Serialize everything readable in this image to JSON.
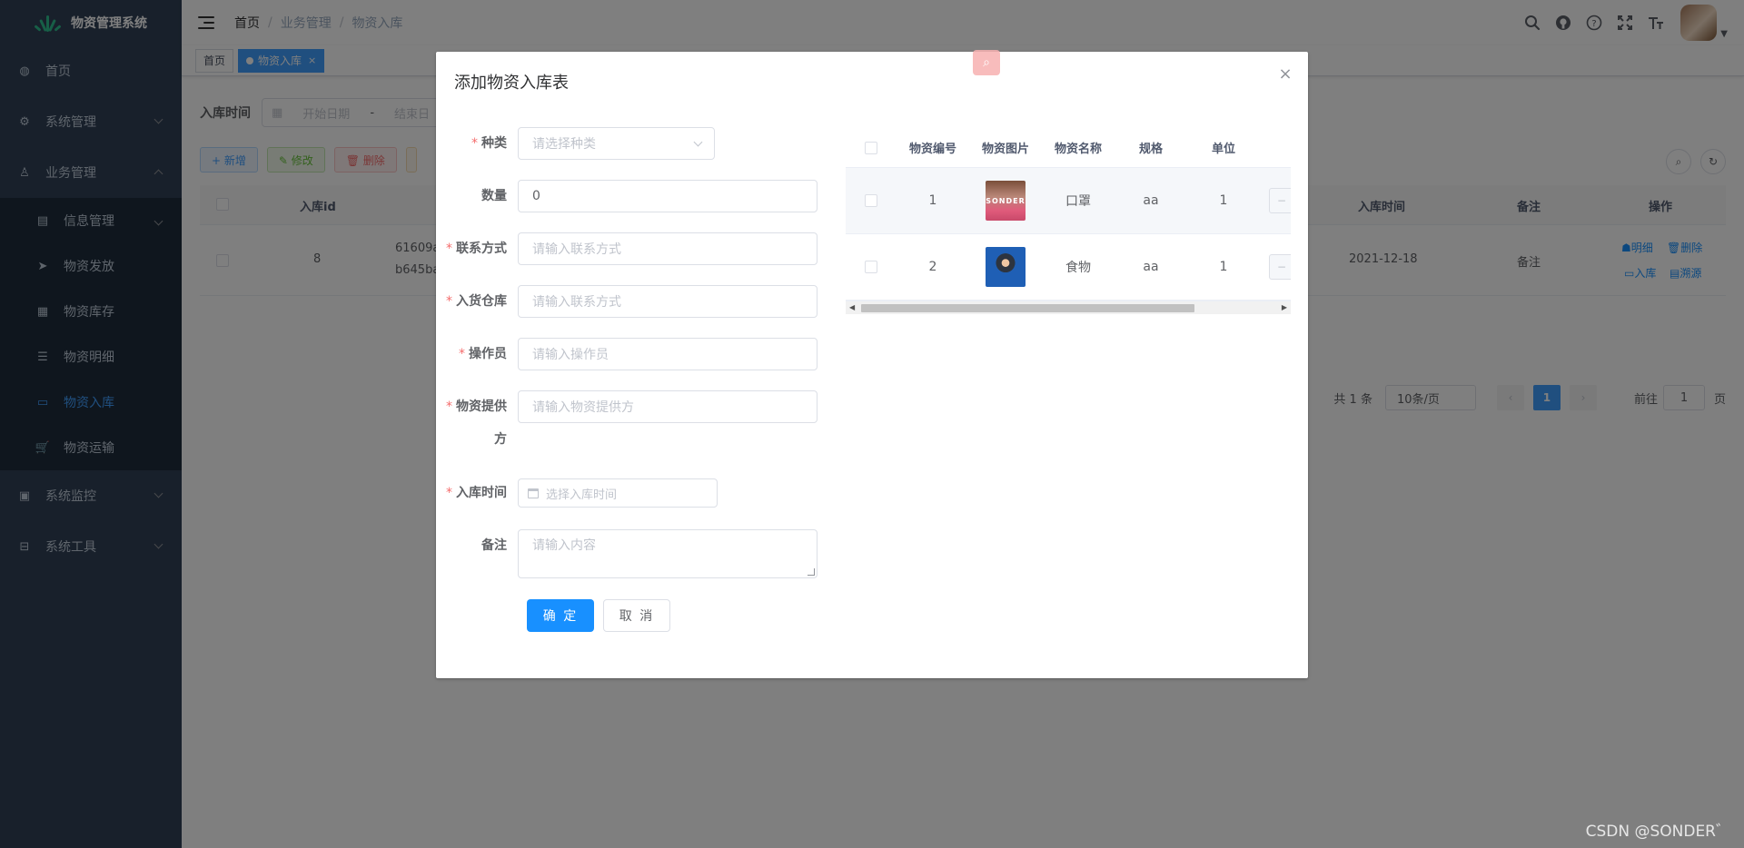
{
  "app": {
    "title": "物资管理系统"
  },
  "sidebar": {
    "items": [
      {
        "label": "首页",
        "icon": "dashboard-icon"
      },
      {
        "label": "系统管理",
        "icon": "gear-icon"
      },
      {
        "label": "业务管理",
        "icon": "user-tree-icon"
      },
      {
        "label": "系统监控",
        "icon": "monitor-icon"
      },
      {
        "label": "系统工具",
        "icon": "toolbox-icon"
      }
    ],
    "submenu": [
      {
        "label": "信息管理",
        "icon": "document-icon"
      },
      {
        "label": "物资发放",
        "icon": "paper-plane-icon"
      },
      {
        "label": "物资库存",
        "icon": "storage-icon"
      },
      {
        "label": "物资明细",
        "icon": "list-tree-icon"
      },
      {
        "label": "物资入库",
        "icon": "rectangle-icon"
      },
      {
        "label": "物资运输",
        "icon": "cart-icon"
      }
    ]
  },
  "navbar": {
    "breadcrumb": [
      "首页",
      "业务管理",
      "物资入库"
    ],
    "icons": [
      "search-icon",
      "github-icon",
      "help-icon",
      "fullscreen-icon",
      "font-size-icon"
    ]
  },
  "tags": {
    "home": "首页",
    "active": "物资入库",
    "close": "×"
  },
  "main": {
    "search_label": "入库时间",
    "start_placeholder": "开始日期",
    "range_sep": "-",
    "end_placeholder": "结束日",
    "buttons": {
      "add": "+ 新增",
      "edit": "✎ 修改",
      "delete": "🗑 删除"
    },
    "table": {
      "headers": {
        "id": "入库id",
        "time": "入库时间",
        "note": "备注",
        "ops": "操作"
      },
      "row": {
        "id": "8",
        "code_line1": "61609a",
        "code_line2": "b645ba",
        "time": "2021-12-18",
        "note": "备注",
        "op_detail": "明细",
        "op_delete": "删除",
        "op_in": "入库",
        "op_trace": "溯源"
      }
    },
    "pagination": {
      "total": "共 1 条",
      "page_size": "10条/页",
      "current": "1",
      "goto_label": "前往",
      "goto_value": "1",
      "page_unit": "页"
    }
  },
  "dialog": {
    "title": "添加物资入库表",
    "close": "×",
    "form": {
      "kind_label": "种类",
      "kind_placeholder": "请选择种类",
      "qty_label": "数量",
      "qty_value": "0",
      "contact_label": "联系方式",
      "contact_placeholder": "请输入联系方式",
      "warehouse_label": "入货仓库",
      "warehouse_placeholder": "请输入联系方式",
      "operator_label": "操作员",
      "operator_placeholder": "请输入操作员",
      "supplier_label_1": "物资提供",
      "supplier_label_2": "方",
      "supplier_placeholder": "请输入物资提供方",
      "time_label": "入库时间",
      "time_placeholder": "选择入库时间",
      "note_label": "备注",
      "note_placeholder": "请输入内容",
      "required_mark": "*"
    },
    "confirm": "确 定",
    "cancel": "取 消",
    "table": {
      "headers": [
        "物资编号",
        "物资图片",
        "物资名称",
        "规格",
        "单位"
      ],
      "rows": [
        {
          "id": "1",
          "image_text": "SONDER",
          "name": "口罩",
          "spec": "aa",
          "unit": "1",
          "action": "−"
        },
        {
          "id": "2",
          "image_text": "",
          "name": "食物",
          "spec": "aa",
          "unit": "1",
          "action": "−"
        }
      ]
    }
  },
  "watermark": "CSDN @SONDER゛"
}
